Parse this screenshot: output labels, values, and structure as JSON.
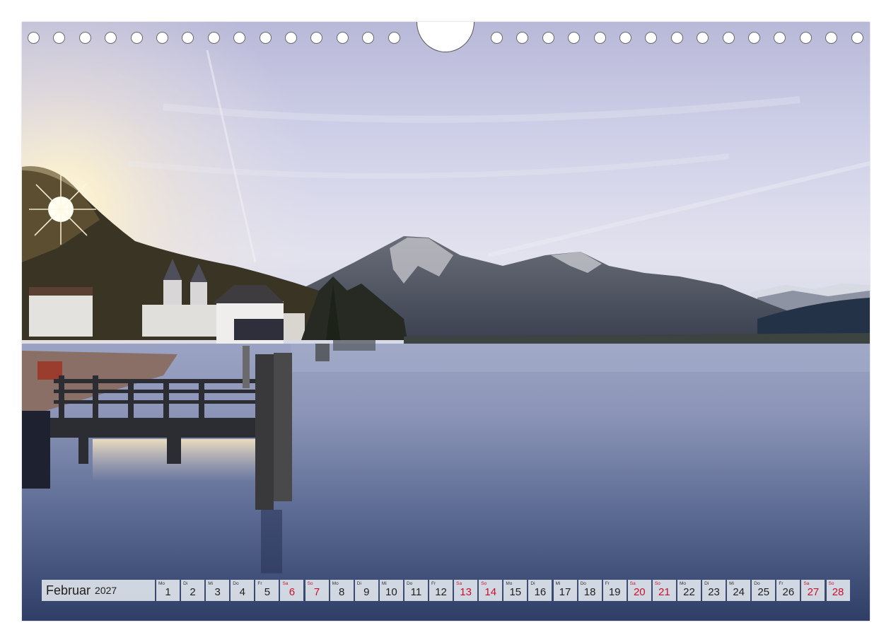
{
  "calendar": {
    "month": "Februar",
    "year": "2027",
    "days": [
      {
        "weekday": "Mo",
        "day": "1",
        "weekend": false
      },
      {
        "weekday": "Di",
        "day": "2",
        "weekend": false
      },
      {
        "weekday": "Mi",
        "day": "3",
        "weekend": false
      },
      {
        "weekday": "Do",
        "day": "4",
        "weekend": false
      },
      {
        "weekday": "Fr",
        "day": "5",
        "weekend": false
      },
      {
        "weekday": "Sa",
        "day": "6",
        "weekend": true
      },
      {
        "weekday": "So",
        "day": "7",
        "weekend": true
      },
      {
        "weekday": "Mo",
        "day": "8",
        "weekend": false
      },
      {
        "weekday": "Di",
        "day": "9",
        "weekend": false
      },
      {
        "weekday": "Mi",
        "day": "10",
        "weekend": false
      },
      {
        "weekday": "Do",
        "day": "11",
        "weekend": false
      },
      {
        "weekday": "Fr",
        "day": "12",
        "weekend": false
      },
      {
        "weekday": "Sa",
        "day": "13",
        "weekend": true
      },
      {
        "weekday": "So",
        "day": "14",
        "weekend": true
      },
      {
        "weekday": "Mo",
        "day": "15",
        "weekend": false
      },
      {
        "weekday": "Di",
        "day": "16",
        "weekend": false
      },
      {
        "weekday": "Mi",
        "day": "17",
        "weekend": false
      },
      {
        "weekday": "Do",
        "day": "18",
        "weekend": false
      },
      {
        "weekday": "Fr",
        "day": "19",
        "weekend": false
      },
      {
        "weekday": "Sa",
        "day": "20",
        "weekend": true
      },
      {
        "weekday": "So",
        "day": "21",
        "weekend": true
      },
      {
        "weekday": "Mo",
        "day": "22",
        "weekend": false
      },
      {
        "weekday": "Di",
        "day": "23",
        "weekend": false
      },
      {
        "weekday": "Mi",
        "day": "24",
        "weekend": false
      },
      {
        "weekday": "Do",
        "day": "25",
        "weekend": false
      },
      {
        "weekday": "Fr",
        "day": "26",
        "weekend": false
      },
      {
        "weekday": "Sa",
        "day": "27",
        "weekend": true
      },
      {
        "weekday": "So",
        "day": "28",
        "weekend": true
      }
    ]
  },
  "colors": {
    "weekend": "#c8102e",
    "text": "#1e1e1e",
    "day_cell_bg": "#dee4ea"
  }
}
